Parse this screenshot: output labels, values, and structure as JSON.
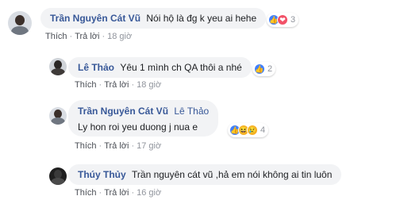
{
  "comments": [
    {
      "name": "Trần Nguyên Cát Vũ",
      "text": "Nói hộ là đg k yeu ai hehe",
      "like": "Thích",
      "reply": "Trả lời",
      "time": "18 giờ",
      "reactions": [
        "like-icon",
        "love-icon"
      ],
      "reaction_count": "3"
    },
    {
      "name": "Lê Thảo",
      "text": "Yêu 1 mình ch QA thôi a nhé",
      "like": "Thích",
      "reply": "Trả lời",
      "time": "18 giờ",
      "reactions": [
        "like-icon"
      ],
      "reaction_count": "2"
    },
    {
      "name": "Trần Nguyên Cát Vũ",
      "tag": "Lê Thảo",
      "text": "Ly hon roi yeu duong j nua e",
      "like": "Thích",
      "reply": "Trả lời",
      "time": "17 giờ",
      "reactions": [
        "like-icon",
        "haha-icon",
        "sad-icon"
      ],
      "reaction_count": "4"
    },
    {
      "name": "Thúy Thủy",
      "text": "Trần nguyên cát vũ ,hả em nói không ai tin luôn",
      "like": "Thích",
      "reply": "Trả lời",
      "time": "16 giờ"
    }
  ],
  "colors": {
    "name": "#385898",
    "bubble": "#f2f3f5",
    "meta": "#90949c",
    "like": "#4080ff",
    "love": "#f25268",
    "haha": "#f7b125"
  }
}
